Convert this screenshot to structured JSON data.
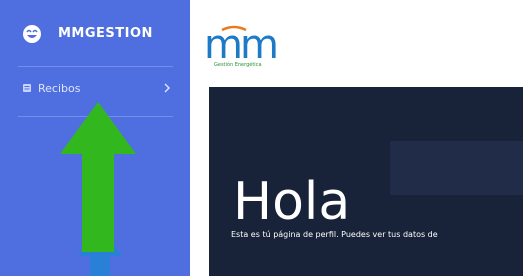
{
  "sidebar": {
    "brand": {
      "name": "MMGESTION",
      "icon": "smiley-logo-icon"
    },
    "items": [
      {
        "label": "Recibos",
        "icon": "receipt-icon",
        "chevron": "chevron-right-icon"
      }
    ]
  },
  "logo": {
    "mark": "mm",
    "subtitle": "Gestión Energética"
  },
  "hero": {
    "title": "Hola",
    "text": "Esta es tú página de perfil. Puedes ver tus datos de"
  },
  "colors": {
    "sidebar": "#4f6fe0",
    "hero_bg": "#182239",
    "arrow_green": "#32b81e",
    "arrow_blue": "#2a7fd6",
    "logo_green": "#2c8f3a",
    "logo_blue": "#1c7ac6"
  }
}
